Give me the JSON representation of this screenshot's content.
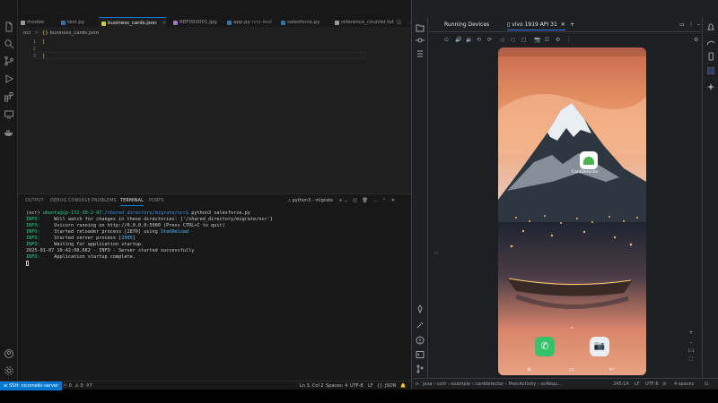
{
  "vscode": {
    "tabs": [
      {
        "label": "moobo",
        "color": "#9a9a9a",
        "active": false
      },
      {
        "label": "test.py",
        "color": "#3572a5",
        "active": false
      },
      {
        "label": "business_cards.json",
        "color": "#cbcb41",
        "active": true
      },
      {
        "label": "REF000001.jpg",
        "color": "#a074c4",
        "active": false
      },
      {
        "label": "app.py",
        "sub": "nco-test",
        "color": "#3572a5",
        "active": false
      },
      {
        "label": "salesforce.py",
        "color": "#3572a5",
        "active": false
      },
      {
        "label": "reference_counter.txt",
        "color": "#9a9a9a",
        "active": false
      }
    ],
    "breadcrumb": {
      "folder": "ocr",
      "sep": ">",
      "file": "business_cards.json"
    },
    "editor": {
      "lines": [
        {
          "n": "1",
          "text": "["
        },
        {
          "n": "2",
          "text": ""
        },
        {
          "n": "3",
          "text": "]"
        }
      ]
    },
    "panel": {
      "tabs": [
        "OUTPUT",
        "DEBUG CONSOLE",
        "PROBLEMS",
        "TERMINAL",
        "PORTS"
      ],
      "active_tab": "TERMINAL",
      "terminal_label": "python3 - migrate",
      "terminal": {
        "prompt_env": "(ocr) ",
        "prompt_user": "ubuntu@ip-172-30-2-97",
        "prompt_path": ":/shared_directory/migrate/ocr$",
        "prompt_cmd": " python3 salesforce.py",
        "lines": [
          {
            "level": "INFO:",
            "msg": "     Will watch for changes in these directories: ['/shared_directory/migrate/ocr']"
          },
          {
            "level": "INFO:",
            "msg": "     Uvicorn running on http://0.0.0.0:5000 (Press CTRL+C to quit)"
          },
          {
            "level": "INFO:",
            "msg": "     Started reloader process [2870] using ",
            "hl": "StatReload"
          },
          {
            "level": "INFO:",
            "msg": "     Started server process [",
            "hl": "2905",
            "tail": "]"
          },
          {
            "level": "INFO:",
            "msg": "     Waiting for application startup."
          },
          {
            "level": "",
            "msg": "2025-01-07 10:42:08,662 - INFO - Server started successfully"
          },
          {
            "level": "INFO:",
            "msg": "     Application startup complete."
          }
        ]
      }
    },
    "status": {
      "remote": "SSH: nicomeiki-server",
      "errors": "0",
      "warnings": "0",
      "ports": "7",
      "position": "Ln 3, Col 2",
      "spaces": "Spaces: 4",
      "encoding": "UTF-8",
      "eol": "LF",
      "language": "JSON"
    }
  },
  "studio": {
    "panel_title": "Running Devices",
    "device_tab": "vivo 1919 API 31",
    "add": "+",
    "gutter_numbers": [
      "24"
    ],
    "phone": {
      "app_label": "CardDetector",
      "colors": {
        "sky": "#f0a26e",
        "snow": "#e8eef2",
        "rock": "#2e3640",
        "sea": "#d8846a",
        "accent": "#4caf50"
      }
    },
    "status": {
      "path": [
        "java",
        "com",
        "example",
        "carddetector",
        "MainActivity",
        "onRequ..."
      ],
      "position": "245:14",
      "eol": "LF",
      "encoding": "UTF-8",
      "indent": "4 spaces"
    }
  }
}
